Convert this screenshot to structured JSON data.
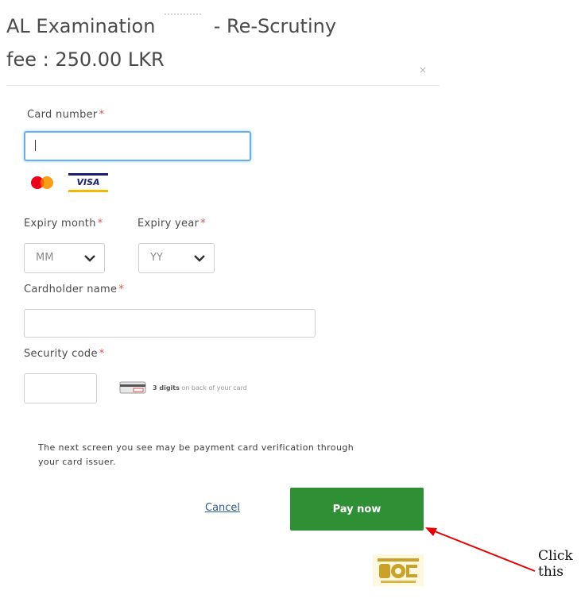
{
  "dialog": {
    "title_prefix": "AL Examination",
    "title_suffix": "- Re-Scrutiny",
    "title_line2": "fee : 250.00 LKR",
    "close_glyph": "×"
  },
  "form": {
    "card_number_label": "Card number",
    "required_mark": "*",
    "card_number_value": "",
    "expiry_month_label": "Expiry month",
    "expiry_year_label": "Expiry year",
    "expiry_month_value": "MM",
    "expiry_year_value": "YY",
    "cardholder_label": "Cardholder name",
    "cardholder_value": "",
    "security_label": "Security code",
    "security_value": "",
    "cvv_hint_bold": "3 digits",
    "cvv_hint_rest": "on back of your card"
  },
  "card_brands": [
    "mastercard-icon",
    "visa-icon"
  ],
  "visa_text": "VISA",
  "notice": "The next screen you see may be payment card verification through your card issuer.",
  "actions": {
    "cancel_label": "Cancel",
    "pay_label": "Pay now"
  },
  "annotation": {
    "callout_text": "Click this"
  },
  "colors": {
    "pay_button": "#2f8f34",
    "required": "#d9534f",
    "focus_border": "#66afe9",
    "link": "#2a5d91",
    "arrow": "#e60000"
  }
}
